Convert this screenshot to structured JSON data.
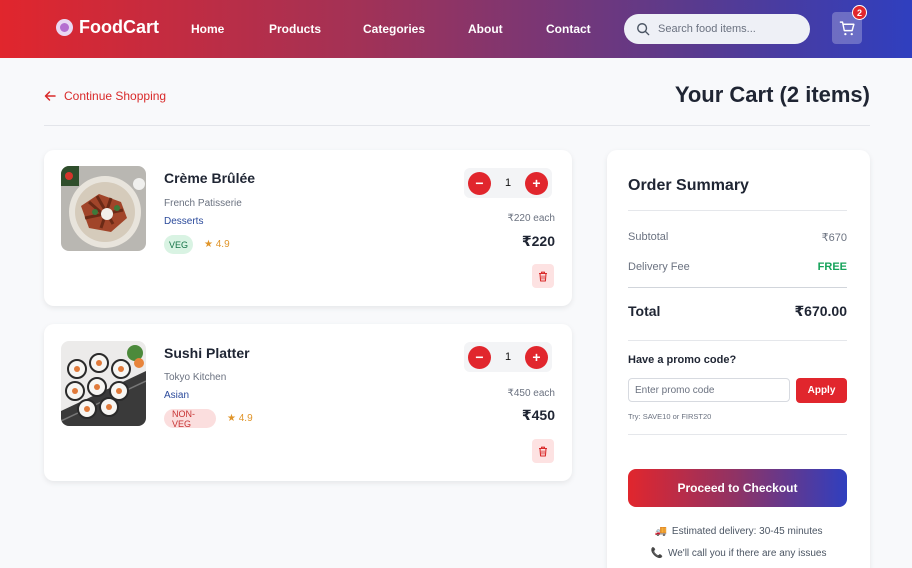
{
  "navbar": {
    "brand": "FoodCart",
    "links": [
      "Home",
      "Products",
      "Categories",
      "About",
      "Contact"
    ],
    "search_placeholder": "Search food items...",
    "cart_count": "2"
  },
  "page": {
    "continue_label": "Continue Shopping",
    "title": "Your Cart (2 items)"
  },
  "items": [
    {
      "name": "Crème Brûlée",
      "restaurant": "French Patisserie",
      "category": "Desserts",
      "tag": "VEG",
      "rating": "★ 4.9",
      "quantity": "1",
      "each": "₹220 each",
      "price": "₹220",
      "minus": "−",
      "plus": "+"
    },
    {
      "name": "Sushi Platter",
      "restaurant": "Tokyo Kitchen",
      "category": "Asian",
      "tag": "NON-VEG",
      "rating": "★ 4.9",
      "quantity": "1",
      "each": "₹450 each",
      "price": "₹450",
      "minus": "−",
      "plus": "+"
    }
  ],
  "summary": {
    "title": "Order Summary",
    "subtotal_label": "Subtotal",
    "subtotal_value": "₹670",
    "delivery_label": "Delivery Fee",
    "delivery_value": "FREE",
    "total_label": "Total",
    "total_value": "₹670.00",
    "promo_title": "Have a promo code?",
    "promo_placeholder": "Enter promo code",
    "apply_label": "Apply",
    "promo_hint": "Try: SAVE10 or FIRST20",
    "checkout_label": "Proceed to Checkout",
    "delivery_estimate": "Estimated delivery: 30-45 minutes",
    "call_note": "We'll call you if there are any issues"
  },
  "colors": {
    "accent": "#e1262d",
    "gradient_end": "#2f3fbf",
    "free": "#16a35a"
  }
}
